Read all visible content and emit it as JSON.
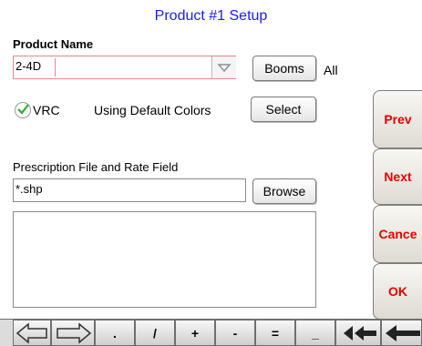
{
  "window": {
    "title": "Product #1 Setup"
  },
  "product": {
    "name_label": "Product Name",
    "name_value": "2-4D",
    "booms_label": "Booms",
    "booms_value": "All"
  },
  "vrc": {
    "checkbox_label": "VRC",
    "checked": true,
    "status_text": "Using Default Colors",
    "select_label": "Select"
  },
  "prescription": {
    "label": "Prescription File and Rate Field",
    "file_value": "*.shp",
    "browse_label": "Browse"
  },
  "side_nav": {
    "prev": "Prev",
    "next": "Next",
    "cancel": "Cance",
    "ok": "OK"
  },
  "keyboard": {
    "keys": [
      ".",
      "/",
      "+",
      "-",
      "=",
      "_"
    ]
  },
  "colors": {
    "title": "#1a1aff",
    "nav_text": "#e60000",
    "check": "#2faa2f"
  }
}
